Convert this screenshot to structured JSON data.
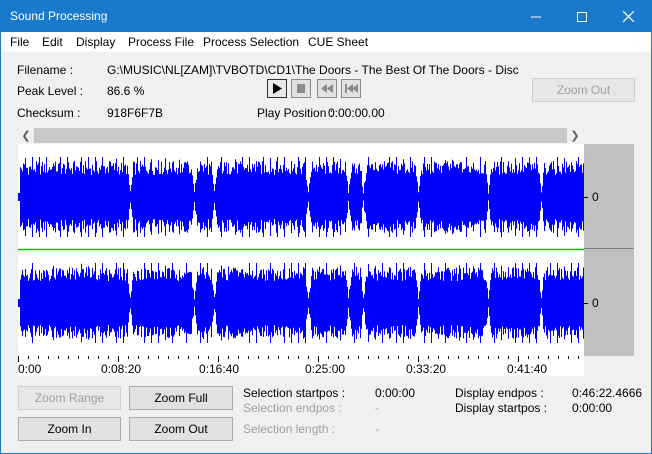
{
  "window": {
    "title": "Sound Processing",
    "accent": "#1979ca"
  },
  "menu": [
    "File",
    "Edit",
    "Display",
    "Process File",
    "Process Selection",
    "CUE Sheet"
  ],
  "info": {
    "filename_label": "Filename :",
    "filename_value": "G:\\MUSIC\\NL[ZAM]\\TVBOTD\\CD1\\The Doors - The Best Of The Doors - Disc",
    "peak_label": "Peak Level :",
    "peak_value": "86.6 %",
    "checksum_label": "Checksum :",
    "checksum_value": "918F6F7B",
    "play_label": "Play Position :",
    "play_value": "0:00:00.00"
  },
  "zoom_out_top": "Zoom Out",
  "channels": [
    {
      "level_label": "0",
      "color": "#0000ff"
    },
    {
      "level_label": "0",
      "color": "#0000ff"
    }
  ],
  "separator_color": "#00c000",
  "timeline": [
    "0:00",
    "0:08:20",
    "0:16:40",
    "0:25:00",
    "0:33:20",
    "0:41:40"
  ],
  "buttons": {
    "zoom_range": "Zoom Range",
    "zoom_full": "Zoom Full",
    "zoom_in": "Zoom In",
    "zoom_out": "Zoom Out"
  },
  "selection": {
    "startpos_label": "Selection startpos :",
    "startpos_value": "0:00:00",
    "endpos_label": "Selection endpos :",
    "endpos_value": "-",
    "length_label": "Selection length :",
    "length_value": "-"
  },
  "display": {
    "endpos_label": "Display endpos :",
    "endpos_value": "0:46:22.4666",
    "startpos_label": "Display startpos :",
    "startpos_value": "0:00:00"
  }
}
